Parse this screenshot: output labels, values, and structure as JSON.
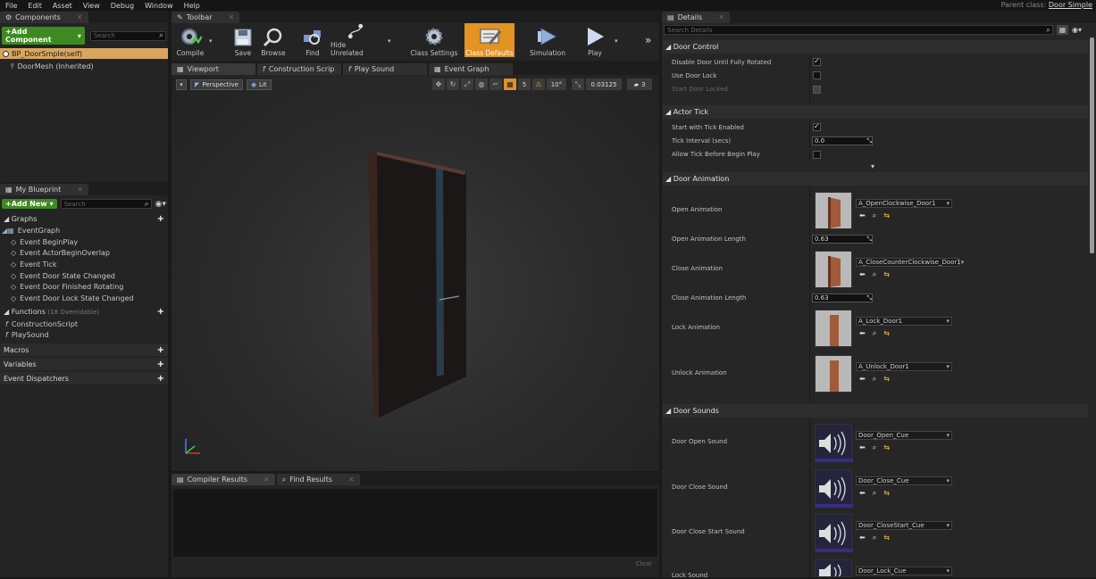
{
  "menu": [
    "File",
    "Edit",
    "Asset",
    "View",
    "Debug",
    "Window",
    "Help"
  ],
  "parent_class_label": "Parent class:",
  "parent_class_value": "Door Simple",
  "components": {
    "tab": "Components",
    "add_button": "+Add Component",
    "search_placeholder": "Search",
    "root": "BP_DoorSmple(self)",
    "child": "DoorMesh (Inherited)"
  },
  "my_blueprint": {
    "tab": "My Blueprint",
    "add_button": "+Add New",
    "search_placeholder": "Search",
    "graphs_label": "Graphs",
    "event_graph": "EventGraph",
    "events": [
      "Event BeginPlay",
      "Event ActorBeginOverlap",
      "Event Tick",
      "Event Door State Changed",
      "Event Door Finished Rotating",
      "Event Door Lock State Changed"
    ],
    "functions_label": "Functions",
    "functions_overridable": "(18 Overridable)",
    "functions": [
      "ConstructionScript",
      "PlaySound"
    ],
    "macros_label": "Macros",
    "variables_label": "Variables",
    "dispatchers_label": "Event Dispatchers"
  },
  "toolbar": {
    "tab": "Toolbar",
    "compile": "Compile",
    "save": "Save",
    "browse": "Browse",
    "find": "Find",
    "hide_unrelated": "Hide Unrelated",
    "class_settings": "Class Settings",
    "class_defaults": "Class Defaults",
    "simulation": "Simulation",
    "play": "Play"
  },
  "editor_tabs": [
    "Viewport",
    "Construction Scrip",
    "Play Sound",
    "Event Graph"
  ],
  "viewport": {
    "perspective": "Perspective",
    "lit": "Lit",
    "grid_snap": "5",
    "angle_snap": "10°",
    "scale_snap": "0.03125",
    "camera_speed": "3"
  },
  "bottom": {
    "tab_compiler": "Compiler Results",
    "tab_find": "Find Results",
    "clear": "Clear"
  },
  "details": {
    "tab": "Details",
    "search_placeholder": "Search Details",
    "cat_door_control": "Door Control",
    "disable_door": "Disable Door Until Fully Rotated",
    "use_door_lock": "Use Door Lock",
    "start_door_locked": "Start Door Locked",
    "cat_actor_tick": "Actor Tick",
    "start_tick": "Start with Tick Enabled",
    "tick_interval": "Tick Interval (secs)",
    "tick_interval_value": "0.0",
    "allow_tick": "Allow Tick Before Begin Play",
    "cat_door_animation": "Door Animation",
    "open_animation": "Open Animation",
    "open_animation_asset": "A_OpenClockwise_Door1",
    "open_animation_length": "Open Animation Length",
    "open_animation_length_value": "0.63",
    "close_animation": "Close Animation",
    "close_animation_asset": "A_CloseCounterClockwise_Door1",
    "close_animation_length": "Close Animation Length",
    "close_animation_length_value": "0.63",
    "lock_animation": "Lock Animation",
    "lock_animation_asset": "A_Lock_Door1",
    "unlock_animation": "Unlock Animation",
    "unlock_animation_asset": "A_Unlock_Door1",
    "cat_door_sounds": "Door Sounds",
    "door_open_sound": "Door Open Sound",
    "door_open_sound_asset": "Door_Open_Cue",
    "door_close_sound": "Door Close Sound",
    "door_close_sound_asset": "Door_Close_Cue",
    "door_close_start_sound": "Door Close Start Sound",
    "door_close_start_sound_asset": "Door_CloseStart_Cue",
    "lock_sound": "Lock Sound",
    "lock_sound_asset": "Door_Lock_Cue"
  }
}
